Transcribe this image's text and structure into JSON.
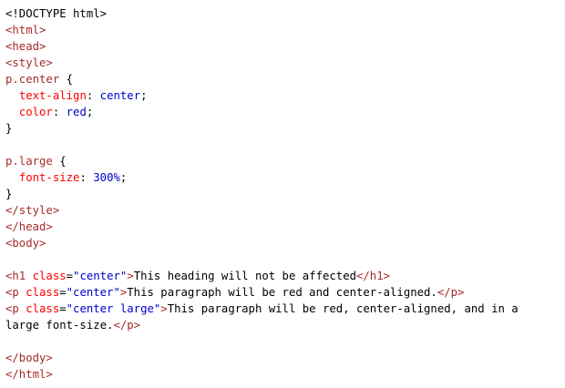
{
  "doctype": "<!DOCTYPE html>",
  "code_lines": [
    {
      "tokens": [
        {
          "t": "doct",
          "v": "<!DOCTYPE html>"
        }
      ]
    },
    {
      "tokens": [
        {
          "t": "tag",
          "v": "<html>"
        }
      ]
    },
    {
      "tokens": [
        {
          "t": "tag",
          "v": "<head>"
        }
      ]
    },
    {
      "tokens": [
        {
          "t": "tag",
          "v": "<style>"
        }
      ]
    },
    {
      "tokens": [
        {
          "t": "sel",
          "v": "p.center"
        },
        {
          "t": "punc",
          "v": " {"
        }
      ]
    },
    {
      "tokens": [
        {
          "t": "punc",
          "v": "  "
        },
        {
          "t": "prop",
          "v": "text-align"
        },
        {
          "t": "punc",
          "v": ": "
        },
        {
          "t": "cval",
          "v": "center"
        },
        {
          "t": "punc",
          "v": ";"
        }
      ]
    },
    {
      "tokens": [
        {
          "t": "punc",
          "v": "  "
        },
        {
          "t": "prop",
          "v": "color"
        },
        {
          "t": "punc",
          "v": ": "
        },
        {
          "t": "cval",
          "v": "red"
        },
        {
          "t": "punc",
          "v": ";"
        }
      ]
    },
    {
      "tokens": [
        {
          "t": "punc",
          "v": "}"
        }
      ]
    },
    {
      "tokens": []
    },
    {
      "tokens": [
        {
          "t": "sel",
          "v": "p.large"
        },
        {
          "t": "punc",
          "v": " {"
        }
      ]
    },
    {
      "tokens": [
        {
          "t": "punc",
          "v": "  "
        },
        {
          "t": "prop",
          "v": "font-size"
        },
        {
          "t": "punc",
          "v": ": "
        },
        {
          "t": "cval",
          "v": "300%"
        },
        {
          "t": "punc",
          "v": ";"
        }
      ]
    },
    {
      "tokens": [
        {
          "t": "punc",
          "v": "}"
        }
      ]
    },
    {
      "tokens": [
        {
          "t": "tag",
          "v": "</style>"
        }
      ]
    },
    {
      "tokens": [
        {
          "t": "tag",
          "v": "</head>"
        }
      ]
    },
    {
      "tokens": [
        {
          "t": "tag",
          "v": "<body>"
        }
      ]
    },
    {
      "tokens": []
    },
    {
      "tokens": [
        {
          "t": "tag",
          "v": "<h1"
        },
        {
          "t": "attr",
          "v": " class"
        },
        {
          "t": "punc",
          "v": "="
        },
        {
          "t": "val",
          "v": "\"center\""
        },
        {
          "t": "tag",
          "v": ">"
        },
        {
          "t": "txt",
          "v": "This heading will not be affected"
        },
        {
          "t": "tag",
          "v": "</h1>"
        }
      ]
    },
    {
      "tokens": [
        {
          "t": "tag",
          "v": "<p"
        },
        {
          "t": "attr",
          "v": " class"
        },
        {
          "t": "punc",
          "v": "="
        },
        {
          "t": "val",
          "v": "\"center\""
        },
        {
          "t": "tag",
          "v": ">"
        },
        {
          "t": "txt",
          "v": "This paragraph will be red and center-aligned."
        },
        {
          "t": "tag",
          "v": "</p>"
        }
      ]
    },
    {
      "tokens": [
        {
          "t": "tag",
          "v": "<p"
        },
        {
          "t": "attr",
          "v": " class"
        },
        {
          "t": "punc",
          "v": "="
        },
        {
          "t": "val",
          "v": "\"center large\""
        },
        {
          "t": "tag",
          "v": ">"
        },
        {
          "t": "txt",
          "v": "This paragraph will be red, center-aligned, and in a"
        }
      ]
    },
    {
      "tokens": [
        {
          "t": "txt",
          "v": "large font-size."
        },
        {
          "t": "tag",
          "v": "</p>"
        }
      ]
    },
    {
      "tokens": []
    },
    {
      "tokens": [
        {
          "t": "tag",
          "v": "</body>"
        }
      ]
    },
    {
      "tokens": [
        {
          "t": "tag",
          "v": "</html>"
        }
      ]
    }
  ],
  "colors": {
    "tag": "#a52a2a",
    "attribute": "#ff0000",
    "attribute_value": "#0000cd",
    "css_property": "#ff0000",
    "css_value": "#0000cd",
    "text": "#000000",
    "background": "#ffffff"
  }
}
